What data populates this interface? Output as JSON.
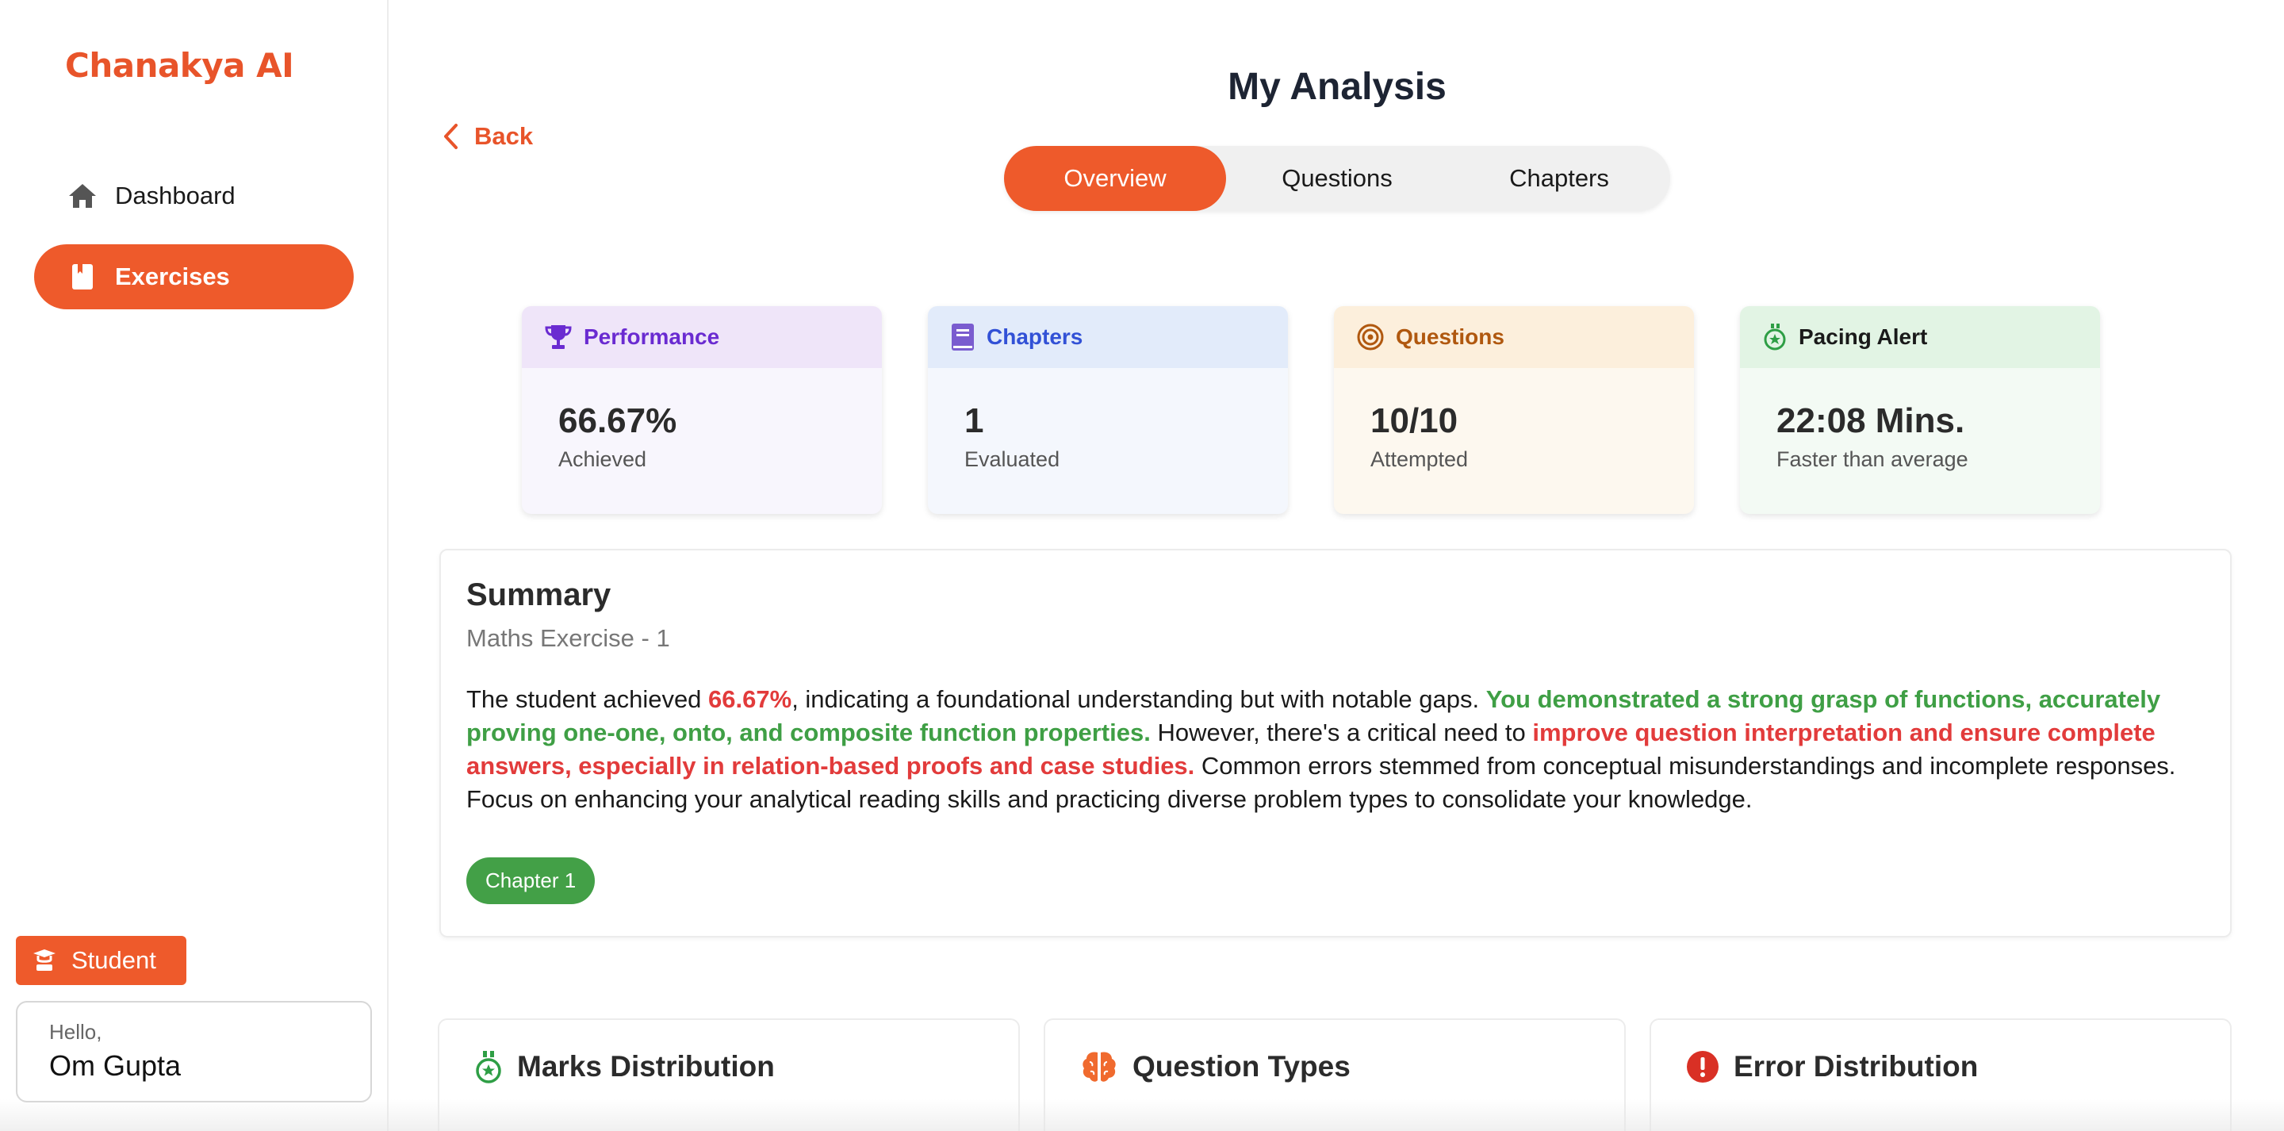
{
  "brand": {
    "name": "Chanakya AI",
    "color": "#e8542a"
  },
  "sidebar": {
    "items": [
      {
        "label": "Dashboard",
        "icon": "home-icon",
        "active": false
      },
      {
        "label": "Exercises",
        "icon": "book-icon",
        "active": true
      }
    ],
    "role": {
      "label": "Student",
      "icon": "teacher-icon"
    },
    "user": {
      "greeting": "Hello,",
      "name": "Om Gupta"
    }
  },
  "header": {
    "title": "My Analysis",
    "back_label": "Back"
  },
  "tabs": [
    {
      "label": "Overview",
      "active": true
    },
    {
      "label": "Questions",
      "active": false
    },
    {
      "label": "Chapters",
      "active": false
    }
  ],
  "stats": {
    "performance": {
      "title": "Performance",
      "value": "66.67%",
      "label": "Achieved",
      "icon": "trophy-icon"
    },
    "chapters": {
      "title": "Chapters",
      "value": "1",
      "label": "Evaluated",
      "icon": "book-icon"
    },
    "questions": {
      "title": "Questions",
      "value": "10/10",
      "label": "Attempted",
      "icon": "target-icon"
    },
    "pacing": {
      "title": "Pacing Alert",
      "value": "22:08 Mins.",
      "label": "Faster than average",
      "icon": "stopwatch-icon"
    }
  },
  "summary": {
    "title": "Summary",
    "subtitle": "Maths Exercise - 1",
    "text": {
      "p1": "The student achieved ",
      "score": "66.67%",
      "p2": ", indicating a foundational understanding but with notable gaps. ",
      "strength": "You demonstrated a strong grasp of functions, accurately proving one-one, onto, and composite function properties.",
      "p3": " However, there's a critical need to ",
      "weakness": "improve question interpretation and ensure complete answers, especially in relation-based proofs and case studies.",
      "p4": " Common errors stemmed from conceptual misunderstandings and incomplete responses. Focus on enhancing your analytical reading skills and practicing diverse problem types to consolidate your knowledge."
    },
    "chip": "Chapter 1"
  },
  "sections": {
    "marks": {
      "title": "Marks Distribution",
      "icon": "medal-icon"
    },
    "qtypes": {
      "title": "Question Types",
      "icon": "brain-icon"
    },
    "errors": {
      "title": "Error Distribution",
      "icon": "alert-icon"
    }
  },
  "colors": {
    "accent": "#ee5a2b",
    "success": "#43a047",
    "danger": "#e23b3b"
  }
}
